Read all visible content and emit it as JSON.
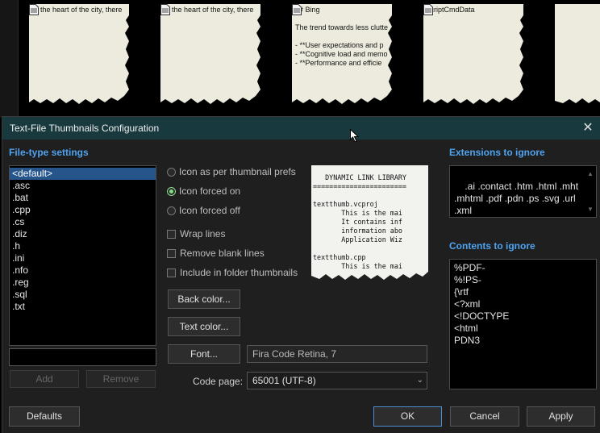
{
  "background_thumbnails": [
    {
      "text": "In the heart of the city, there"
    },
    {
      "text": "In the heart of the city, there"
    },
    {
      "text": "## Bing\n\nThe trend towards less clutte\n\n- **User expectations and p\n- **Cognitive load and memo\n- **Performance and efficie"
    },
    {
      "text": "scriptCmdData"
    },
    {
      "text": ""
    }
  ],
  "dialog": {
    "title": "Text-File Thumbnails Configuration",
    "close_icon": "close-icon",
    "file_type_settings": {
      "label": "File-type settings",
      "items": [
        "<default>",
        ".asc",
        ".bat",
        ".cpp",
        ".cs",
        ".diz",
        ".h",
        ".ini",
        ".nfo",
        ".reg",
        ".sql",
        ".txt"
      ],
      "selected_index": 0,
      "new_ext_value": "",
      "add_label": "Add",
      "remove_label": "Remove"
    },
    "options": {
      "radio_prefs": "Icon as per thumbnail prefs",
      "radio_on": "Icon forced on",
      "radio_off": "Icon forced off",
      "selected_radio": "radio_on",
      "wrap_lines": "Wrap lines",
      "remove_blank_lines": "Remove blank lines",
      "include_folder": "Include in folder thumbnails",
      "back_color": "Back color...",
      "text_color": "Text color...",
      "font_button": "Font...",
      "font_value": "Fira Code Retina, 7",
      "code_page_label": "Code page:",
      "code_page_value": "65001 (UTF-8)"
    },
    "preview_text": "   DYNAMIC LINK LIBRARY\n=======================\n\ntextthumb.vcproj\n       This is the mai\n       It contains inf\n       information abo\n       Application Wiz\n\ntextthumb.cpp\n       This is the mai",
    "extensions_to_ignore": {
      "label": "Extensions to ignore",
      "value": ".ai .contact .htm .html .mht\n.mhtml .pdf .pdn .ps .svg .url\n.xml"
    },
    "contents_to_ignore": {
      "label": "Contents to ignore",
      "lines": [
        "%PDF-",
        "%!PS-",
        "{\\rtf",
        "<?xml",
        "<!DOCTYPE",
        "<html",
        "PDN3"
      ]
    },
    "footer": {
      "defaults": "Defaults",
      "ok": "OK",
      "cancel": "Cancel",
      "apply": "Apply"
    }
  },
  "colors": {
    "accent": "#4ea3f0",
    "titlebar": "#18393d",
    "selection": "#26558c",
    "radio_on": "#7fe07f"
  }
}
